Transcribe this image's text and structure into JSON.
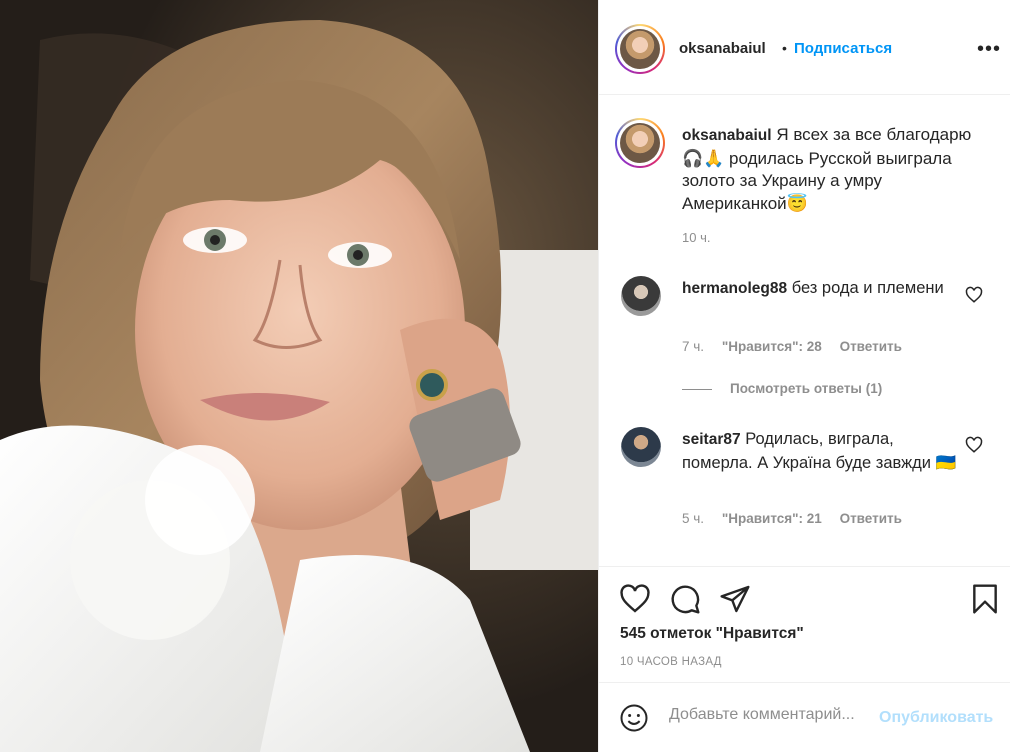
{
  "post": {
    "photo_alt": "photo",
    "username": "oksanabaiul",
    "dot": "•",
    "follow_label": "Подписаться",
    "more_icon": "more-options-icon",
    "more_glyph": "•••"
  },
  "caption": {
    "username": "oksanabaiul",
    "text": "Я всех за все благодарю 🎧🙏 родилась Русской выиграла золото за Украину а умру Американкой😇",
    "time": "10 ч."
  },
  "comments": [
    {
      "username": "hermanoleg88",
      "text": "без рода и племени",
      "time": "7 ч.",
      "likes_label": "\"Нравится\": 28",
      "reply_label": "Ответить",
      "view_replies": "Посмотреть ответы (1)"
    },
    {
      "username": "seitar87",
      "text": "Родилась, виграла, померла. А Україна буде завжди 🇺🇦",
      "time": "5 ч.",
      "likes_label": "\"Нравится\": 21",
      "reply_label": "Ответить"
    }
  ],
  "actions": {
    "likes": "545 отметок \"Нравится\"",
    "time": "10 ЧАСОВ НАЗАД"
  },
  "add_comment": {
    "placeholder": "Добавьте комментарий...",
    "publish_label": "Опубликовать"
  },
  "colors": {
    "link_blue": "#0095f6",
    "publish_disabled": "#b2dffc",
    "secondary_text": "#8e8e8e"
  }
}
